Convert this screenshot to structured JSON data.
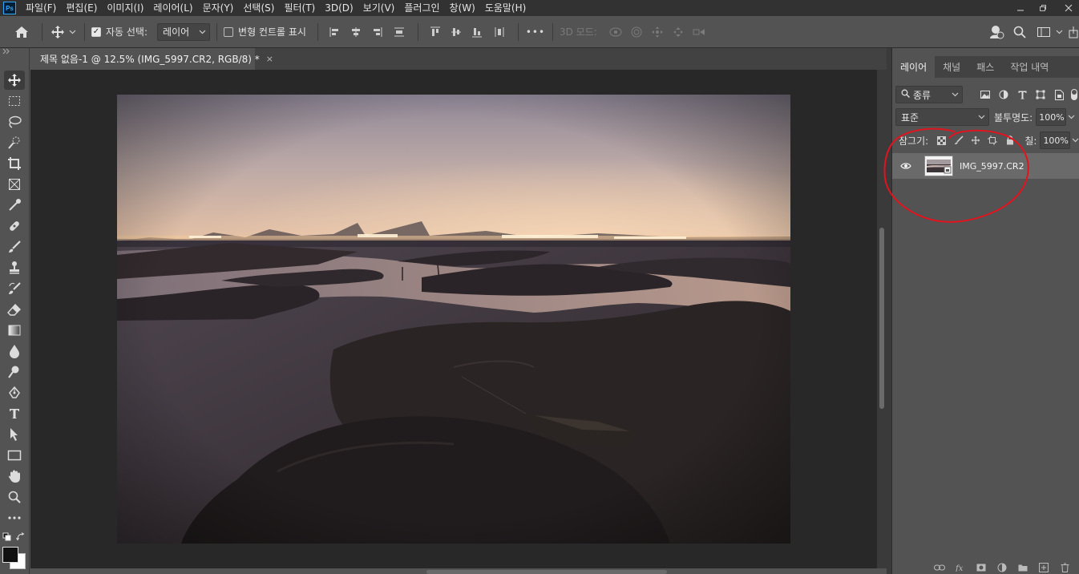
{
  "app": {
    "logo": "Ps",
    "menu": [
      "파일(F)",
      "편집(E)",
      "이미지(I)",
      "레이어(L)",
      "문자(Y)",
      "선택(S)",
      "필터(T)",
      "3D(D)",
      "보기(V)",
      "플러그인",
      "창(W)",
      "도움말(H)"
    ]
  },
  "options": {
    "auto_select_label": "자동 선택:",
    "auto_select_value": "레이어",
    "auto_select_checked": true,
    "transform_controls_label": "변형 컨트롤 표시",
    "transform_controls_checked": false,
    "mode_3d_label": "3D 모드:",
    "more_label": "•••"
  },
  "document": {
    "tab_title": "제목 없음-1 @ 12.5% (IMG_5997.CR2, RGB/8) *",
    "close_glyph": "×"
  },
  "layers_panel": {
    "tabs": [
      "레이어",
      "채널",
      "패스",
      "작업 내역"
    ],
    "active_tab": 0,
    "filter_label": "종류",
    "blend_mode": "표준",
    "opacity_label": "불투명도:",
    "opacity_value": "100%",
    "lock_label": "잠그기:",
    "fill_label": "칠:",
    "fill_value": "100%",
    "layers": [
      {
        "name": "IMG_5997.CR2",
        "visible": true,
        "selected": true
      }
    ]
  },
  "annotation": {
    "color": "#e0141e"
  },
  "colors": {
    "menubar_bg": "#323232",
    "panel_bg": "#535353",
    "canvas_bg": "#282828",
    "selected_layer_bg": "#6a6a6a"
  }
}
